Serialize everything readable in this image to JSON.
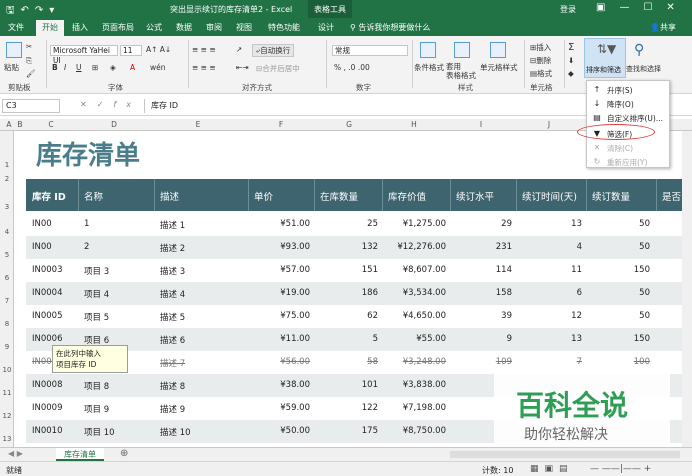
{
  "titlebar": {
    "document": "突出显示续订的库存清单2  -  Excel",
    "tools": "表格工具",
    "login": "登录"
  },
  "tabs": [
    "文件",
    "开始",
    "插入",
    "页面布局",
    "公式",
    "数据",
    "审阅",
    "视图",
    "特色功能",
    "设计"
  ],
  "tell_me": "告诉我你想要做什么",
  "share": "共享",
  "ribbon": {
    "paste": "粘贴",
    "clipboard": "剪贴板",
    "font_name": "Microsoft YaHei UI",
    "font_size": "11",
    "font_group": "字体",
    "wrap_text": "自动换行",
    "merge": "合并后居中",
    "align_group": "对齐方式",
    "number_format": "常规",
    "number_group": "数字",
    "cond_format": "条件格式",
    "table_format": "套用\n表格格式",
    "cell_style": "单元格样式",
    "styles_group": "样式",
    "insert": "插入",
    "delete": "删除",
    "format": "格式",
    "cells_group": "单元格",
    "sort_filter": "排序和筛选",
    "find_select": "查找和选择"
  },
  "formula_bar": {
    "name_box": "C3",
    "formula": "库存 ID"
  },
  "columns": [
    "A",
    "B",
    "C",
    "D",
    "E",
    "F",
    "G",
    "H",
    "I",
    "J",
    "K"
  ],
  "rows": [
    "1",
    "2",
    "3",
    "4",
    "5",
    "6",
    "7",
    "8",
    "9",
    "10",
    "11",
    "12",
    "13",
    "14"
  ],
  "sheet_title": "库存清单",
  "table_headers": [
    "库存 ID",
    "名称",
    "描述",
    "单价",
    "在库数量",
    "库存价值",
    "续订水平",
    "续订时间(天)",
    "续订数量",
    "是否"
  ],
  "table_rows": [
    {
      "id": "IN00",
      "name": "1",
      "desc": "描述 1",
      "price": "¥51.00",
      "qty": "25",
      "value": "¥1,275.00",
      "level": "29",
      "days": "13",
      "reorder": "50"
    },
    {
      "id": "IN00",
      "name": "2",
      "desc": "描述 2",
      "price": "¥93.00",
      "qty": "132",
      "value": "¥12,276.00",
      "level": "231",
      "days": "4",
      "reorder": "50"
    },
    {
      "id": "IN0003",
      "name": "项目 3",
      "desc": "描述 3",
      "price": "¥57.00",
      "qty": "151",
      "value": "¥8,607.00",
      "level": "114",
      "days": "11",
      "reorder": "150"
    },
    {
      "id": "IN0004",
      "name": "项目 4",
      "desc": "描述 4",
      "price": "¥19.00",
      "qty": "186",
      "value": "¥3,534.00",
      "level": "158",
      "days": "6",
      "reorder": "50"
    },
    {
      "id": "IN0005",
      "name": "项目 5",
      "desc": "描述 5",
      "price": "¥75.00",
      "qty": "62",
      "value": "¥4,650.00",
      "level": "39",
      "days": "12",
      "reorder": "50"
    },
    {
      "id": "IN0006",
      "name": "项目 6",
      "desc": "描述 6",
      "price": "¥11.00",
      "qty": "5",
      "value": "¥55.00",
      "level": "9",
      "days": "13",
      "reorder": "150"
    },
    {
      "id": "IN0007",
      "name": "项目 7",
      "desc": "描述 7",
      "price": "¥56.00",
      "qty": "58",
      "value": "¥3,248.00",
      "level": "109",
      "days": "7",
      "reorder": "100"
    },
    {
      "id": "IN0008",
      "name": "项目 8",
      "desc": "描述 8",
      "price": "¥38.00",
      "qty": "101",
      "value": "¥3,838.00",
      "level": "",
      "days": "",
      "reorder": ""
    },
    {
      "id": "IN0009",
      "name": "项目 9",
      "desc": "描述 9",
      "price": "¥59.00",
      "qty": "122",
      "value": "¥7,198.00",
      "level": "",
      "days": "",
      "reorder": ""
    },
    {
      "id": "IN0010",
      "name": "项目 10",
      "desc": "描述 10",
      "price": "¥50.00",
      "qty": "175",
      "value": "¥8,750.00",
      "level": "",
      "days": "",
      "reorder": ""
    }
  ],
  "tooltip": "在此列中输入\n项目库存 ID",
  "sort_menu": [
    "升序(S)",
    "降序(O)",
    "自定义排序(U)...",
    "筛选(F)",
    "清除(C)",
    "重新应用(Y)"
  ],
  "sheet_tab": "库存清单",
  "status": {
    "ready": "就绪",
    "count": "计数: 10"
  },
  "watermark": {
    "brand": "百科全说",
    "tagline": "助你轻松解决"
  },
  "colors": {
    "excel_green": "#217346",
    "header_teal": "#3e6470",
    "title_teal": "#4a7d8c",
    "highlight": "#e03c3c"
  }
}
